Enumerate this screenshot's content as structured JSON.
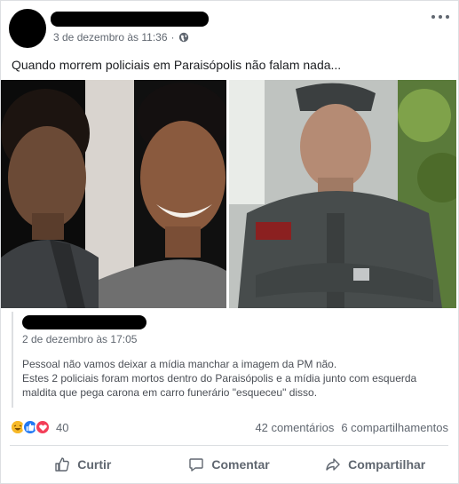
{
  "post": {
    "timestamp": "3 de dezembro às 11:36",
    "privacy_icon": "globe-icon",
    "text": "Quando morrem policiais em Paraisópolis não falam nada..."
  },
  "shared": {
    "date": "2 de dezembro às 17:05",
    "body_lines": [
      "Pessoal não vamos deixar a mídia manchar a imagem da PM não.",
      "Estes 2 policiais foram mortos dentro do Paraisópolis e a mídia junto com esquerda",
      "maldita que pega carona em carro funerário \"esqueceu\" disso."
    ]
  },
  "stats": {
    "reactions": [
      "haha",
      "like",
      "love"
    ],
    "reaction_count": "40",
    "comments": "42 comentários",
    "shares": "6 compartilhamentos"
  },
  "actions": {
    "like": "Curtir",
    "comment": "Comentar",
    "share": "Compartilhar"
  },
  "colors": {
    "meta_text": "#606770",
    "like_blue": "#2078f4",
    "love_red": "#f33e58",
    "haha_yellow": "#f7b928"
  }
}
